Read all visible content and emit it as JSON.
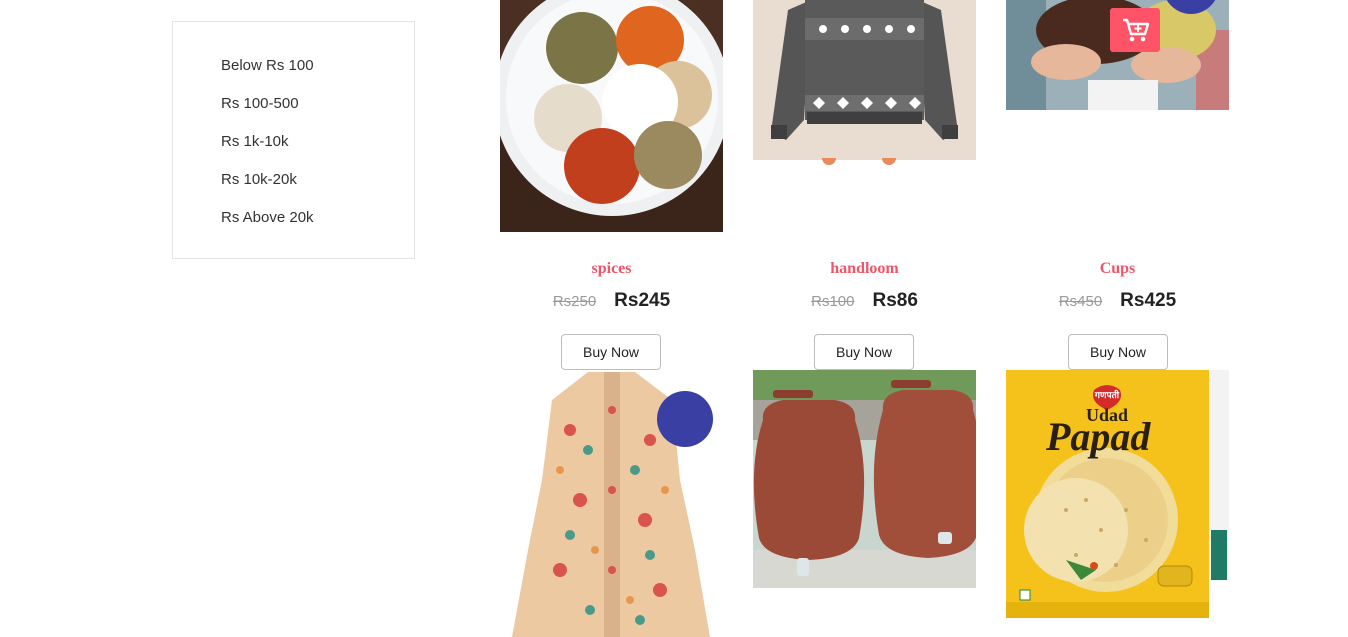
{
  "filters": {
    "price_ranges": [
      "Below Rs 100",
      "Rs 100-500",
      "Rs 1k-10k",
      "Rs 10k-20k",
      "Rs Above 20k"
    ]
  },
  "products": [
    {
      "title": "spices",
      "old_price": "Rs250",
      "new_price": "Rs245",
      "button": "Buy Now",
      "image": "spices-plate"
    },
    {
      "title": "handloom",
      "old_price": "Rs100",
      "new_price": "Rs86",
      "button": "Buy Now",
      "image": "knit-sweater"
    },
    {
      "title": "Cups",
      "old_price": "Rs450",
      "new_price": "Rs425",
      "button": "Buy Now",
      "image": "knitted-cup-cosy"
    }
  ],
  "second_row": [
    {
      "image": "embroidered-coat"
    },
    {
      "image": "clay-water-pots"
    },
    {
      "image": "udad-papad-pack",
      "brand": "गणपती",
      "text_line1": "Udad",
      "text_line2": "Papad"
    }
  ],
  "colors": {
    "accent": "#f0566a",
    "badge_blue": "#3a3fa3",
    "cart_red": "#ff5468"
  },
  "icons": {
    "cart": "add-to-cart-icon"
  }
}
